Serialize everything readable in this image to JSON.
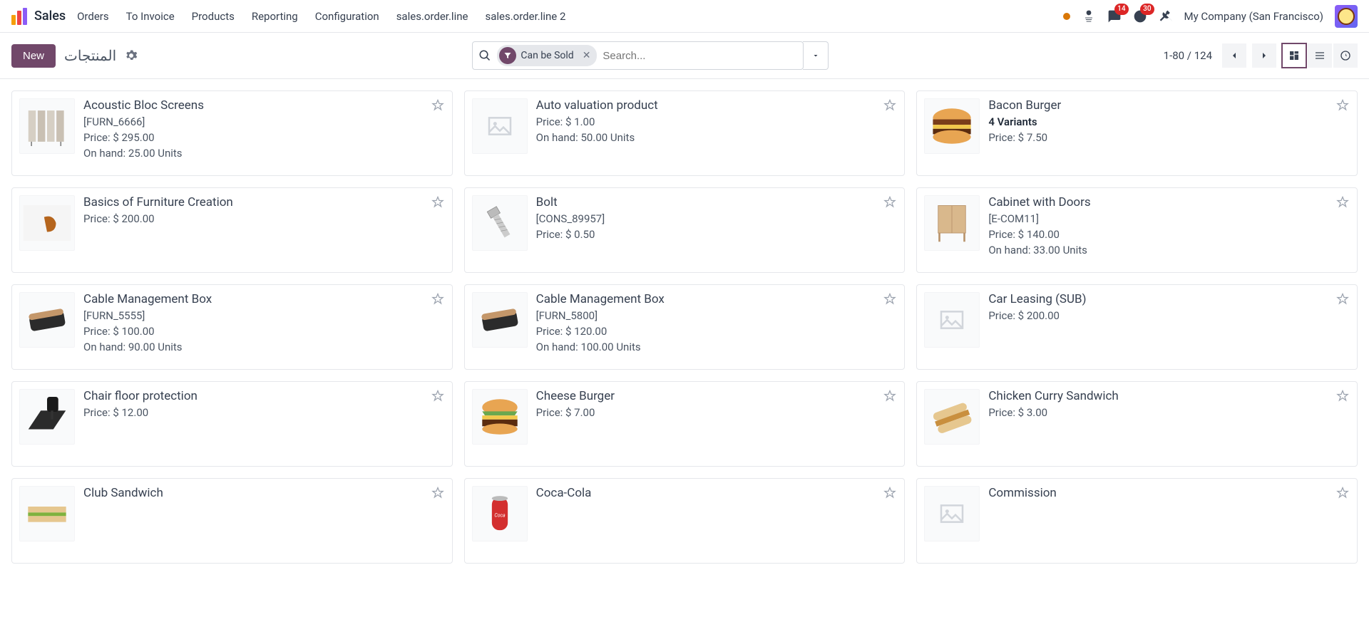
{
  "header": {
    "app_name": "Sales",
    "nav": [
      "Orders",
      "To Invoice",
      "Products",
      "Reporting",
      "Configuration",
      "sales.order.line",
      "sales.order.line 2"
    ],
    "messages_badge": "14",
    "activities_badge": "30",
    "company": "My Company (San Francisco)"
  },
  "toolbar": {
    "new_label": "New",
    "breadcrumb": "المنتجات",
    "filter_label": "Can be Sold",
    "search_placeholder": "Search...",
    "pager": "1-80 / 124"
  },
  "products": [
    {
      "name": "Acoustic Bloc Screens",
      "code": "[FURN_6666]",
      "price": "Price: $ 295.00",
      "onhand": "On hand: 25.00 Units",
      "img": "screens"
    },
    {
      "name": "Auto valuation product",
      "code": "",
      "price": "Price: $ 1.00",
      "onhand": "On hand: 50.00 Units",
      "img": "placeholder"
    },
    {
      "name": "Bacon Burger",
      "code": "",
      "variants": "4 Variants",
      "price": "Price: $ 7.50",
      "img": "baconburger"
    },
    {
      "name": "Basics of Furniture Creation",
      "code": "",
      "price": "Price: $ 200.00",
      "img": "furniture"
    },
    {
      "name": "Bolt",
      "code": "[CONS_89957]",
      "price": "Price: $ 0.50",
      "img": "bolt"
    },
    {
      "name": "Cabinet with Doors",
      "code": "[E-COM11]",
      "price": "Price: $ 140.00",
      "onhand": "On hand: 33.00 Units",
      "img": "cabinet"
    },
    {
      "name": "Cable Management Box",
      "code": "[FURN_5555]",
      "price": "Price: $ 100.00",
      "onhand": "On hand: 90.00 Units",
      "img": "cablebox"
    },
    {
      "name": "Cable Management Box",
      "code": "[FURN_5800]",
      "price": "Price: $ 120.00",
      "onhand": "On hand: 100.00 Units",
      "img": "cablebox"
    },
    {
      "name": "Car Leasing (SUB)",
      "code": "",
      "price": "Price: $ 200.00",
      "img": "placeholder"
    },
    {
      "name": "Chair floor protection",
      "code": "",
      "price": "Price: $ 12.00",
      "img": "chairmat"
    },
    {
      "name": "Cheese Burger",
      "code": "",
      "price": "Price: $ 7.00",
      "img": "cheeseburger"
    },
    {
      "name": "Chicken Curry Sandwich",
      "code": "",
      "price": "Price: $ 3.00",
      "img": "sandwich"
    },
    {
      "name": "Club Sandwich",
      "code": "",
      "price": "",
      "img": "clubsandwich"
    },
    {
      "name": "Coca-Cola",
      "code": "",
      "price": "",
      "img": "coke"
    },
    {
      "name": "Commission",
      "code": "",
      "price": "",
      "img": "placeholder"
    }
  ]
}
